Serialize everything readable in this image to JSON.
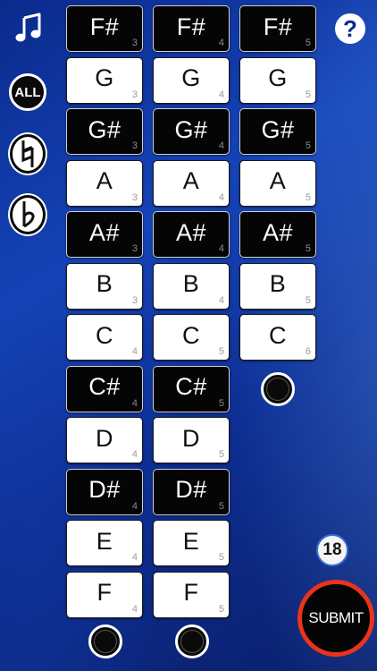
{
  "toolbar": {
    "music_icon": "music-note-icon",
    "help_icon": "question-mark-icon",
    "all_label": "ALL",
    "natural_icon": "natural-sign-icon",
    "flat_icon": "flat-sign-icon"
  },
  "columns": [
    {
      "keys": [
        {
          "name": "F#",
          "octave": "3",
          "type": "black"
        },
        {
          "name": "G",
          "octave": "3",
          "type": "white"
        },
        {
          "name": "G#",
          "octave": "3",
          "type": "black"
        },
        {
          "name": "A",
          "octave": "3",
          "type": "white"
        },
        {
          "name": "A#",
          "octave": "3",
          "type": "black"
        },
        {
          "name": "B",
          "octave": "3",
          "type": "white"
        },
        {
          "name": "C",
          "octave": "4",
          "type": "white"
        },
        {
          "name": "C#",
          "octave": "4",
          "type": "black"
        },
        {
          "name": "D",
          "octave": "4",
          "type": "white"
        },
        {
          "name": "D#",
          "octave": "4",
          "type": "black"
        },
        {
          "name": "E",
          "octave": "4",
          "type": "white"
        },
        {
          "name": "F",
          "octave": "4",
          "type": "white"
        }
      ]
    },
    {
      "keys": [
        {
          "name": "F#",
          "octave": "4",
          "type": "black"
        },
        {
          "name": "G",
          "octave": "4",
          "type": "white"
        },
        {
          "name": "G#",
          "octave": "4",
          "type": "black"
        },
        {
          "name": "A",
          "octave": "4",
          "type": "white"
        },
        {
          "name": "A#",
          "octave": "4",
          "type": "black"
        },
        {
          "name": "B",
          "octave": "4",
          "type": "white"
        },
        {
          "name": "C",
          "octave": "5",
          "type": "white"
        },
        {
          "name": "C#",
          "octave": "5",
          "type": "black"
        },
        {
          "name": "D",
          "octave": "5",
          "type": "white"
        },
        {
          "name": "D#",
          "octave": "5",
          "type": "black"
        },
        {
          "name": "E",
          "octave": "5",
          "type": "white"
        },
        {
          "name": "F",
          "octave": "5",
          "type": "white"
        }
      ]
    },
    {
      "keys": [
        {
          "name": "F#",
          "octave": "5",
          "type": "black"
        },
        {
          "name": "G",
          "octave": "5",
          "type": "white"
        },
        {
          "name": "G#",
          "octave": "5",
          "type": "black"
        },
        {
          "name": "A",
          "octave": "5",
          "type": "white"
        },
        {
          "name": "A#",
          "octave": "5",
          "type": "black"
        },
        {
          "name": "B",
          "octave": "5",
          "type": "white"
        },
        {
          "name": "C",
          "octave": "6",
          "type": "white"
        }
      ]
    }
  ],
  "count": "18",
  "submit_label": "SUBMIT",
  "colors": {
    "background": "#1544b8",
    "submit_ring": "#e8341c",
    "count_ring": "#3b6fd6"
  }
}
